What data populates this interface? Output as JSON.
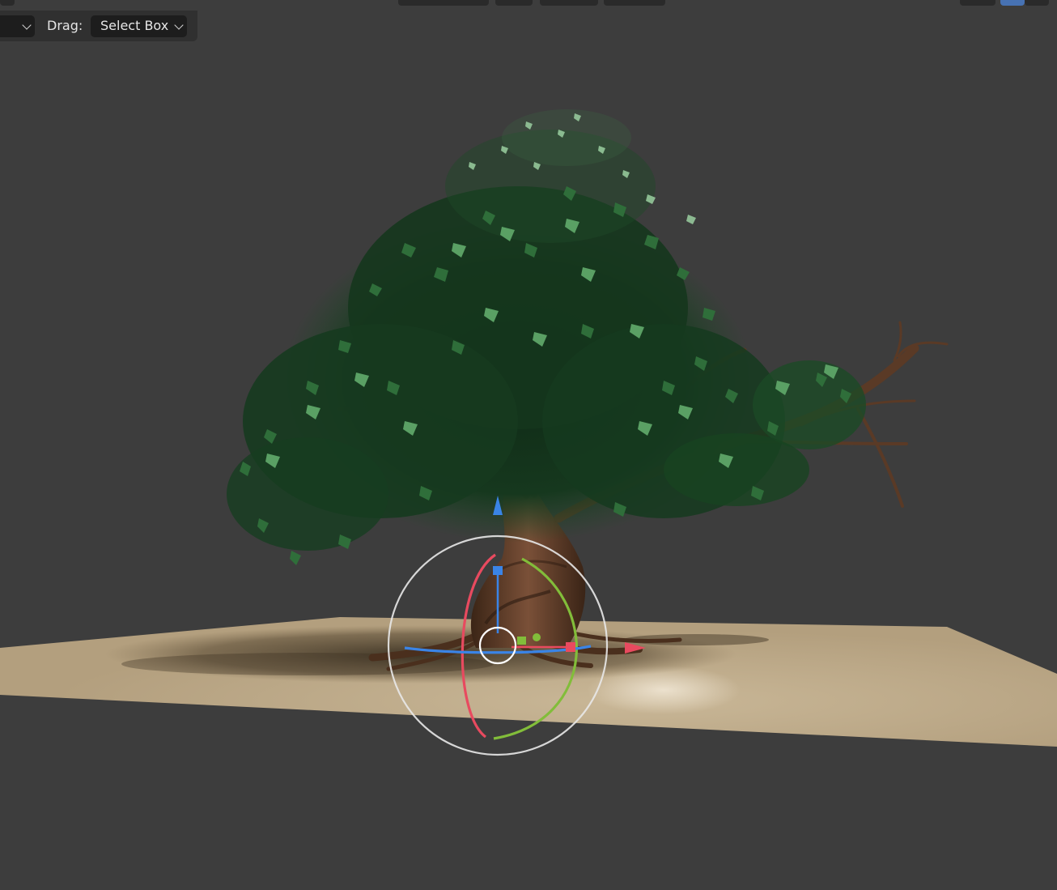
{
  "toolbar": {
    "drag_label": "Drag:",
    "drag_value": "Select Box"
  },
  "icons": {
    "dropdown_chevron": "chevron-down-icon",
    "gizmo": "transform-gizmo"
  },
  "colors": {
    "viewport_bg": "#3d3d3d",
    "ground": "#b9a584",
    "gizmo_x": "#e84a5f",
    "gizmo_y": "#82bd3a",
    "gizmo_z": "#3a84e6",
    "gizmo_ring": "#e8e8e8",
    "header_active": "#4772b3"
  }
}
